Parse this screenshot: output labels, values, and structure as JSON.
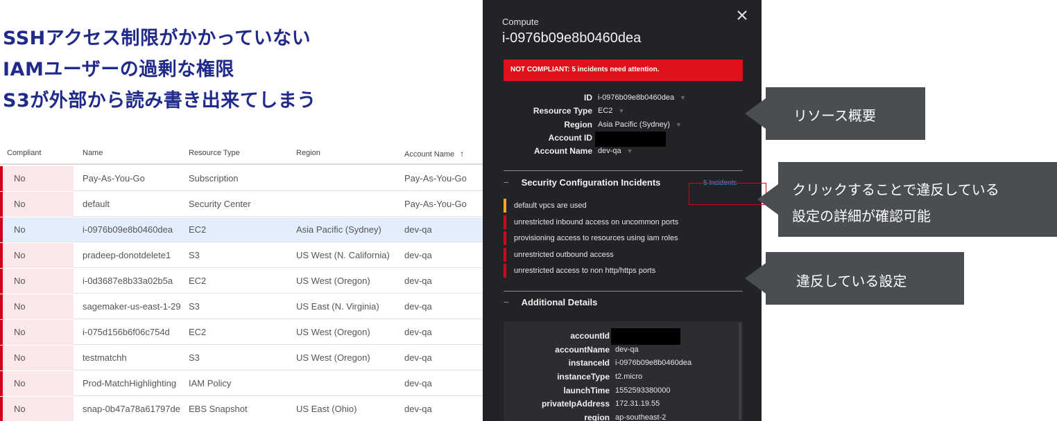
{
  "headline": {
    "lines": [
      "SSHアクセス制限がかかっていない",
      "IAMユーザーの過剰な権限",
      "S3が外部から読み書き出来てしまう"
    ]
  },
  "table": {
    "headers": {
      "compliant": "Compliant",
      "name": "Name",
      "resource_type": "Resource Type",
      "region": "Region",
      "account_name": "Account Name",
      "sort_arrow": "↑"
    },
    "rows": [
      {
        "compliant": "No",
        "name": "Pay-As-You-Go",
        "resource_type": "Subscription",
        "region": "",
        "account_name": "Pay-As-You-Go"
      },
      {
        "compliant": "No",
        "name": "default",
        "resource_type": "Security Center",
        "region": "",
        "account_name": "Pay-As-You-Go"
      },
      {
        "compliant": "No",
        "name": "i-0976b09e8b0460dea",
        "resource_type": "EC2",
        "region": "Asia Pacific (Sydney)",
        "account_name": "dev-qa"
      },
      {
        "compliant": "No",
        "name": "pradeep-donotdelete1",
        "resource_type": "S3",
        "region": "US West (N. California)",
        "account_name": "dev-qa"
      },
      {
        "compliant": "No",
        "name": "i-0d3687e8b33a02b5a",
        "resource_type": "EC2",
        "region": "US West (Oregon)",
        "account_name": "dev-qa"
      },
      {
        "compliant": "No",
        "name": "sagemaker-us-east-1-29",
        "resource_type": "S3",
        "region": "US East (N. Virginia)",
        "account_name": "dev-qa"
      },
      {
        "compliant": "No",
        "name": "i-075d156b6f06c754d",
        "resource_type": "EC2",
        "region": "US West (Oregon)",
        "account_name": "dev-qa"
      },
      {
        "compliant": "No",
        "name": "testmatchh",
        "resource_type": "S3",
        "region": "US West (Oregon)",
        "account_name": "dev-qa"
      },
      {
        "compliant": "No",
        "name": "Prod-MatchHighlighting",
        "resource_type": "IAM Policy",
        "region": "",
        "account_name": "dev-qa"
      },
      {
        "compliant": "No",
        "name": "snap-0b47a78a61797de",
        "resource_type": "EBS Snapshot",
        "region": "US East (Ohio)",
        "account_name": "dev-qa"
      }
    ],
    "selected_index": 2
  },
  "panel": {
    "kind": "Compute",
    "resource_id": "i-0976b09e8b0460dea",
    "close_icon": "close-icon",
    "banner": "NOT COMPLIANT: 5 incidents need attention.",
    "summary": [
      {
        "key": "ID",
        "value": "i-0976b09e8b0460dea",
        "filter": true
      },
      {
        "key": "Resource Type",
        "value": "EC2",
        "filter": true
      },
      {
        "key": "Region",
        "value": "Asia Pacific (Sydney)",
        "filter": true
      },
      {
        "key": "Account ID",
        "value": "",
        "redacted": true
      },
      {
        "key": "Account Name",
        "value": "dev-qa",
        "filter": true
      }
    ],
    "incidents_section": {
      "dash": "−",
      "title": "Security Configuration Incidents",
      "count_link": "5 Incidents",
      "items": [
        {
          "text": "default vpcs are used",
          "severity": "warning"
        },
        {
          "text": "unrestricted inbound access on uncommon ports",
          "severity": "critical"
        },
        {
          "text": "provisioning access to resources using iam roles",
          "severity": "critical"
        },
        {
          "text": "unrestricted outbound access",
          "severity": "critical"
        },
        {
          "text": "unrestricted access to non http/https ports",
          "severity": "critical"
        }
      ]
    },
    "details_section": {
      "dash": "−",
      "title": "Additional Details",
      "items": [
        {
          "key": "accountId",
          "value": "",
          "redacted": true
        },
        {
          "key": "accountName",
          "value": "dev-qa"
        },
        {
          "key": "instanceId",
          "value": "i-0976b09e8b0460dea"
        },
        {
          "key": "instanceType",
          "value": "t2.micro"
        },
        {
          "key": "launchTime",
          "value": "1552593380000"
        },
        {
          "key": "privateIpAddress",
          "value": "172.31.19.55"
        },
        {
          "key": "region",
          "value": "ap-southeast-2"
        }
      ]
    }
  },
  "callouts": {
    "summary": "リソース概要",
    "click_line1": "クリックすることで違反している",
    "click_line2": "設定の詳細が確認可能",
    "violations": "違反している設定"
  },
  "colors": {
    "headline": "#1f2a8a",
    "noncompliant_flag": "#d0021b",
    "warning_flag": "#f5a623",
    "selected_row": "#e2eefb",
    "panel_bg": "#222326",
    "banner": "#e0101d",
    "callout_bg": "#4a4d52",
    "link": "#4a8fd8"
  }
}
